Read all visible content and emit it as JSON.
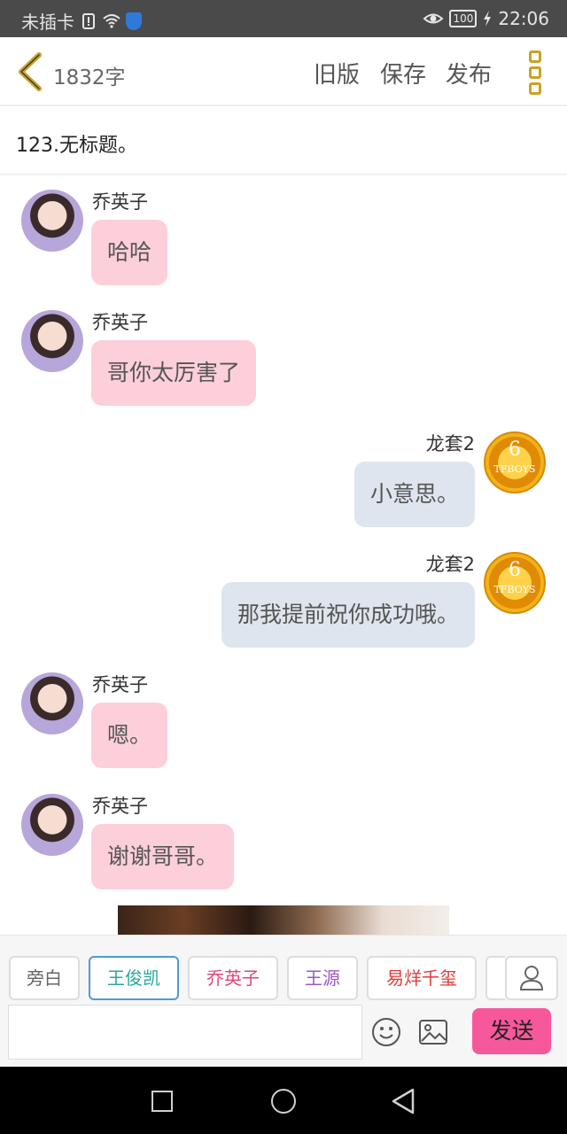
{
  "status_bar": {
    "carrier": "未插卡",
    "battery": "100",
    "time": "22:06"
  },
  "header": {
    "word_count": "1832字",
    "old_version_label": "旧版",
    "save_label": "保存",
    "publish_label": "发布"
  },
  "chapter": {
    "title": "123.无标题。"
  },
  "messages": [
    {
      "speaker": "乔英子",
      "text": "哈哈",
      "side": "left"
    },
    {
      "speaker": "乔英子",
      "text": "哥你太厉害了",
      "side": "left"
    },
    {
      "speaker": "龙套2",
      "text": "小意思。",
      "side": "right"
    },
    {
      "speaker": "龙套2",
      "text": "那我提前祝你成功哦。",
      "side": "right"
    },
    {
      "speaker": "乔英子",
      "text": "嗯。",
      "side": "left"
    },
    {
      "speaker": "乔英子",
      "text": "谢谢哥哥。",
      "side": "left"
    }
  ],
  "avatar_badge": {
    "number": "6",
    "text": "TFBOYS"
  },
  "characters": [
    {
      "label": "旁白",
      "color": "#666666"
    },
    {
      "label": "王俊凯",
      "color": "#2aa6a0",
      "selected": true
    },
    {
      "label": "乔英子",
      "color": "#e0457b"
    },
    {
      "label": "王源",
      "color": "#9b59c6"
    },
    {
      "label": "易烊千玺",
      "color": "#e03a3a"
    }
  ],
  "composer": {
    "input_value": "",
    "send_label": "发送"
  },
  "colors": {
    "left_bubble": "#fdcfdb",
    "right_bubble": "#dee5ee",
    "send_button": "#f7589c",
    "accent_gold": "#c9a227"
  }
}
